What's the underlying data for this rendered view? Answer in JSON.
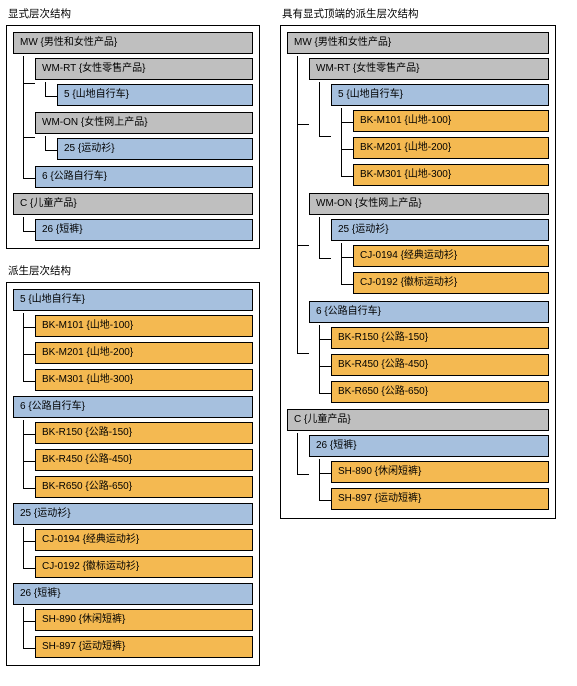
{
  "left": {
    "explicit": {
      "title": "显式层次结构",
      "tree": [
        {
          "label": "MW {男性和女性产品}",
          "class": "gray",
          "children": [
            {
              "label": "WM-RT {女性零售产品}",
              "class": "gray",
              "children": [
                {
                  "label": "5 {山地自行车}",
                  "class": "blue"
                }
              ]
            },
            {
              "label": "WM-ON {女性网上产品}",
              "class": "gray",
              "children": [
                {
                  "label": "25 {运动衫}",
                  "class": "blue"
                }
              ]
            },
            {
              "label": "6 {公路自行车}",
              "class": "blue"
            }
          ]
        },
        {
          "label": "C {儿童产品}",
          "class": "gray",
          "children": [
            {
              "label": "26 {短裤}",
              "class": "blue"
            }
          ]
        }
      ]
    },
    "derived": {
      "title": "派生层次结构",
      "tree": [
        {
          "label": "5 {山地自行车}",
          "class": "blue",
          "children": [
            {
              "label": "BK-M101 {山地-100}",
              "class": "orange"
            },
            {
              "label": "BK-M201 {山地-200}",
              "class": "orange"
            },
            {
              "label": "BK-M301 {山地-300}",
              "class": "orange"
            }
          ]
        },
        {
          "label": "6 {公路自行车}",
          "class": "blue",
          "children": [
            {
              "label": "BK-R150 {公路-150}",
              "class": "orange"
            },
            {
              "label": "BK-R450 {公路-450}",
              "class": "orange"
            },
            {
              "label": "BK-R650 {公路-650}",
              "class": "orange"
            }
          ]
        },
        {
          "label": "25 {运动衫}",
          "class": "blue",
          "children": [
            {
              "label": "CJ-0194 {经典运动衫}",
              "class": "orange"
            },
            {
              "label": "CJ-0192 {徽标运动衫}",
              "class": "orange"
            }
          ]
        },
        {
          "label": "26 {短裤}",
          "class": "blue",
          "children": [
            {
              "label": "SH-890 {休闲短裤}",
              "class": "orange"
            },
            {
              "label": "SH-897 {运动短裤}",
              "class": "orange"
            }
          ]
        }
      ]
    }
  },
  "right": {
    "derived_with_top": {
      "title": "具有显式顶端的派生层次结构",
      "tree": [
        {
          "label": "MW {男性和女性产品}",
          "class": "gray",
          "children": [
            {
              "label": "WM-RT {女性零售产品}",
              "class": "gray",
              "children": [
                {
                  "label": "5 {山地自行车}",
                  "class": "blue",
                  "children": [
                    {
                      "label": "BK-M101 {山地-100}",
                      "class": "orange"
                    },
                    {
                      "label": "BK-M201 {山地-200}",
                      "class": "orange"
                    },
                    {
                      "label": "BK-M301 {山地-300}",
                      "class": "orange"
                    }
                  ]
                }
              ]
            },
            {
              "label": "WM-ON {女性网上产品}",
              "class": "gray",
              "children": [
                {
                  "label": "25 {运动衫}",
                  "class": "blue",
                  "children": [
                    {
                      "label": "CJ-0194 {经典运动衫}",
                      "class": "orange"
                    },
                    {
                      "label": "CJ-0192 {徽标运动衫}",
                      "class": "orange"
                    }
                  ]
                }
              ]
            },
            {
              "label": "6 {公路自行车}",
              "class": "blue",
              "children": [
                {
                  "label": "BK-R150 {公路-150}",
                  "class": "orange"
                },
                {
                  "label": "BK-R450 {公路-450}",
                  "class": "orange"
                },
                {
                  "label": "BK-R650 {公路-650}",
                  "class": "orange"
                }
              ]
            }
          ]
        },
        {
          "label": "C {儿童产品}",
          "class": "gray",
          "children": [
            {
              "label": "26 {短裤}",
              "class": "blue",
              "children": [
                {
                  "label": "SH-890 {休闲短裤}",
                  "class": "orange"
                },
                {
                  "label": "SH-897 {运动短裤}",
                  "class": "orange"
                }
              ]
            }
          ]
        }
      ]
    }
  }
}
